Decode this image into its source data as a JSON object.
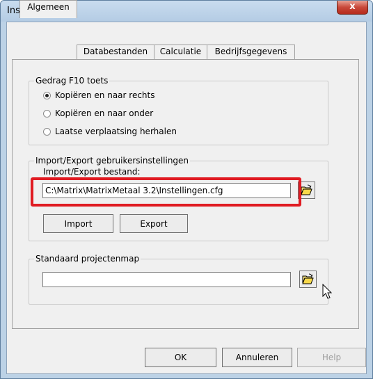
{
  "window": {
    "title": "Instellingen",
    "close_glyph": "x"
  },
  "tabs": [
    {
      "label": "Algemeen"
    },
    {
      "label": "Databestanden"
    },
    {
      "label": "Calculatie"
    },
    {
      "label": "Bedrijfsgegevens"
    }
  ],
  "f10_group": {
    "title": "Gedrag F10 toets",
    "options": [
      {
        "label": "Kopiëren en naar rechts",
        "selected": true
      },
      {
        "label": "Kopiëren en naar onder",
        "selected": false
      },
      {
        "label": "Laatse verplaatsing herhalen",
        "selected": false
      }
    ]
  },
  "import_export_group": {
    "title": "Import/Export gebruikersinstellingen",
    "file_label": "Import/Export bestand:",
    "file_value": "C:\\Matrix\\MatrixMetaal 3.2\\Instellingen.cfg",
    "import_label": "Import",
    "export_label": "Export",
    "browse_icon": "folder-open-icon"
  },
  "project_group": {
    "title": "Standaard projectenmap",
    "folder_value": "",
    "browse_icon": "folder-open-icon"
  },
  "footer": {
    "ok_label": "OK",
    "cancel_label": "Annuleren",
    "help_label": "Help"
  },
  "colors": {
    "highlight": "#e01b22",
    "close_button": "#c8483a"
  }
}
